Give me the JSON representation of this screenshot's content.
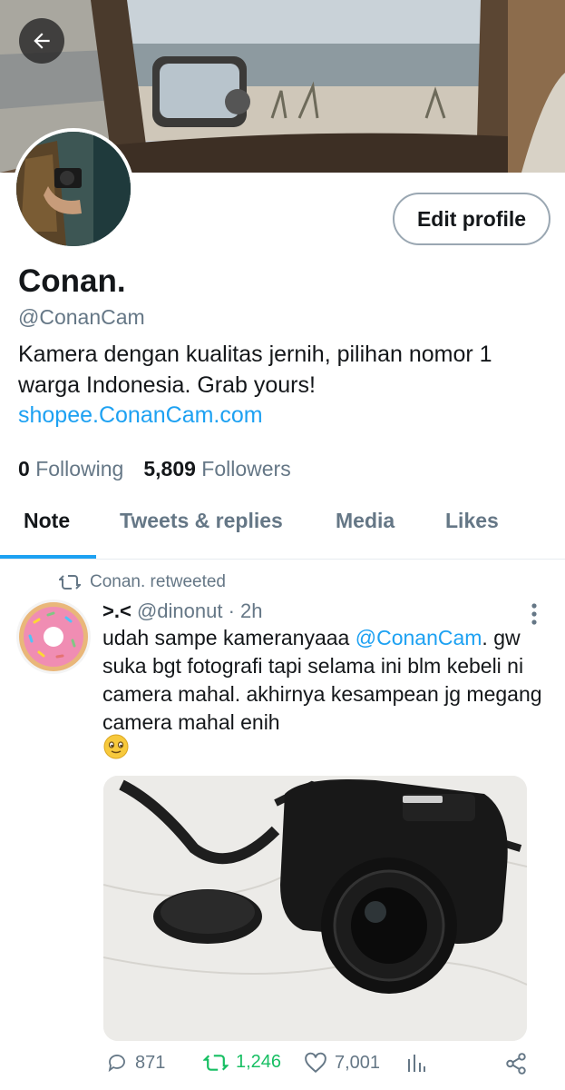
{
  "profile": {
    "name": "Conan.",
    "handle": "@ConanCam",
    "bio": "Kamera dengan kualitas jernih, pilihan nomor 1 warga Indonesia. Grab yours!",
    "link": "shopee.ConanCam.com",
    "edit_label": "Edit profile",
    "following_count": "0",
    "following_label": "Following",
    "followers_count": "5,809",
    "followers_label": "Followers"
  },
  "tabs": [
    {
      "label": "Note",
      "active": true
    },
    {
      "label": "Tweets & replies",
      "active": false
    },
    {
      "label": "Media",
      "active": false
    },
    {
      "label": "Likes",
      "active": false
    }
  ],
  "tweet": {
    "retweet_label": "Conan. retweeted",
    "display_name": ">.<",
    "username": "@dinonut",
    "time": "· 2h",
    "text_before": "udah sampe kameranyaaa ",
    "mention": "@ConanCam",
    "text_after": ". gw suka bgt fotografi tapi selama ini blm kebeli ni camera mahal. akhirnya kesampean jg megang camera mahal enih",
    "emoji": "smiling-face-emoji",
    "replies": "871",
    "retweets": "1,246",
    "likes": "7,001"
  },
  "colors": {
    "accent": "#1da1f2",
    "retweet_green": "#17bf63",
    "secondary_text": "#657786"
  },
  "icons": [
    "back-arrow-icon",
    "retweet-icon",
    "more-vertical-icon",
    "reply-icon",
    "like-icon",
    "analytics-icon",
    "share-icon"
  ]
}
